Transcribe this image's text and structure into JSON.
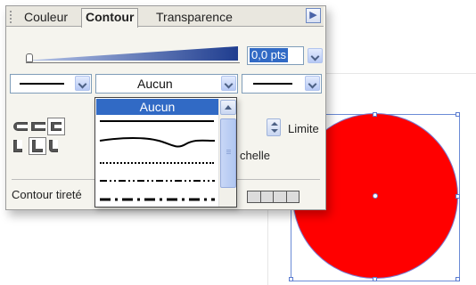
{
  "tabs": [
    {
      "label": "Couleur",
      "active": false
    },
    {
      "label": "Contour",
      "active": true
    },
    {
      "label": "Transparence",
      "active": false
    }
  ],
  "panel_menu_icon": "triangle-right-icon",
  "weight": {
    "value": "0,0 pts"
  },
  "combos": {
    "start_cap_style": "solid-line",
    "dash_style": "Aucun",
    "end_cap_style": "solid-line"
  },
  "dropdown": {
    "items": [
      {
        "label": "Aucun",
        "selected": true
      },
      {
        "label": "",
        "style": "solid"
      },
      {
        "label": "",
        "style": "wavy"
      },
      {
        "label": "",
        "style": "dotted"
      },
      {
        "label": "",
        "style": "dash-dot-dot"
      },
      {
        "label": "",
        "style": "long-dash"
      }
    ]
  },
  "labels": {
    "limit": "Limite",
    "scale": "chelle",
    "dashed": "Contour tireté"
  },
  "colors": {
    "accent": "#316ac5",
    "shape_fill": "#ff0000",
    "selection": "#6b8bd6"
  }
}
